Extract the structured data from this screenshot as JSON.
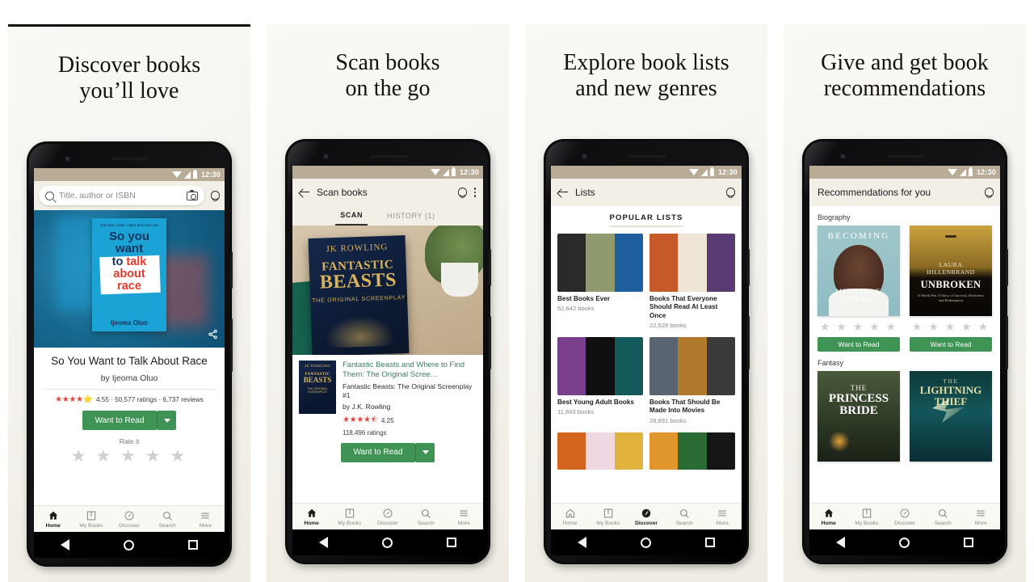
{
  "panels": [
    {
      "headline": "Discover books\nyou’ll love",
      "status": {
        "time": "12:30"
      },
      "search": {
        "placeholder": "Title, author or ISBN"
      },
      "book": {
        "cover": {
          "banner": "THE NEW YORK TIMES BESTSELLER",
          "line1": "So you",
          "line2": "want",
          "line3_dark": "to ",
          "line3_red": "talk",
          "line4_red": "about",
          "line5_red": "race",
          "author": "Ijeoma Oluo"
        },
        "title": "So You Want to Talk About Race",
        "byline": "by Ijeoma Oluo",
        "stars": "★★★★⭐",
        "rating_text": "4.55 · 50,577 ratings · 6,737 reviews",
        "cta": "Want to Read",
        "rate_it": "Rate it",
        "rate_stars": "★ ★ ★ ★ ★"
      },
      "bottom_nav_active": "Home"
    },
    {
      "headline": "Scan books\non the go",
      "status": {
        "time": "12:30"
      },
      "appbar_title": "Scan books",
      "tabs": [
        {
          "label": "SCAN",
          "active": true
        },
        {
          "label": "HISTORY (1)",
          "active": false
        }
      ],
      "result": {
        "cover_lines": {
          "a": "JK ROWLING",
          "b": "FANTASTIC",
          "c": "BEASTS",
          "d": "THE ORIGINAL SCREENPLAY"
        },
        "title": "Fantastic Beasts and Where to Find Them: The Original Scree…",
        "series": "Fantastic Beasts: The Original Screenplay #1",
        "author": "by J.K. Rowling",
        "stars": "★★★★⯪",
        "rating": "4.25",
        "ratings_count": "118,496 ratings",
        "cta": "Want to Read"
      },
      "bottom_nav_active": "Home"
    },
    {
      "headline": "Explore book lists\nand new genres",
      "status": {
        "time": "12:30"
      },
      "appbar_title": "Lists",
      "section_title": "POPULAR LISTS",
      "lists": [
        {
          "name": "Best Books Ever",
          "count": "52,642 books",
          "colors": [
            "#2a2a2a",
            "#8f9a6e",
            "#1f5f9e"
          ]
        },
        {
          "name": "Books That Everyone Should Read At Least Once",
          "count": "22,529 books",
          "colors": [
            "#c75a2a",
            "#efe6d8",
            "#5a3a72"
          ]
        },
        {
          "name": "Best Young Adult Books",
          "count": "11,843 books",
          "colors": [
            "#7a3f8c",
            "#101010",
            "#145a5a"
          ]
        },
        {
          "name": "Books That Should Be Made Into Movies",
          "count": "28,891 books",
          "colors": [
            "#5a6470",
            "#b07a2c",
            "#3a3a3a"
          ]
        }
      ],
      "partial_lists": [
        {
          "colors": [
            "#d4651f",
            "#f0d8e2",
            "#e0b23c"
          ]
        },
        {
          "colors": [
            "#e0962c",
            "#2b6b35",
            "#161616"
          ]
        }
      ],
      "bottom_nav_active": "Discover"
    },
    {
      "headline": "Give and get book\nrecommendations",
      "status": {
        "time": "12:30"
      },
      "appbar_title": "Recommendations for you",
      "sections": [
        {
          "name": "Biography",
          "books": [
            {
              "cover": "becoming",
              "title_top": "BECOMING",
              "name_lines": "MICHELLE\nOBAMA",
              "stars": "★ ★ ★ ★ ★",
              "cta": "Want to Read"
            },
            {
              "cover": "unbroken",
              "author": "LAURA\nHILLENBRAND",
              "title_top": "UNBROKEN",
              "subtitle": "A World War II Story of Survival, Resilience and Redemption",
              "stars": "★ ★ ★ ★ ★",
              "cta": "Want to Read"
            }
          ]
        },
        {
          "name": "Fantasy",
          "books": [
            {
              "cover": "princess",
              "title_top": "THE",
              "name_lines": "PRINCESS\nBRIDE"
            },
            {
              "cover": "lightning",
              "title_top": "THE",
              "l2": "LIGHTNING",
              "l3": "THIEF"
            }
          ]
        }
      ],
      "bottom_nav_active": "Home"
    }
  ],
  "bottom_nav": [
    {
      "label": "Home",
      "icon": "home-icon"
    },
    {
      "label": "My Books",
      "icon": "book-icon"
    },
    {
      "label": "Discover",
      "icon": "compass-icon"
    },
    {
      "label": "Search",
      "icon": "search-icon"
    },
    {
      "label": "More",
      "icon": "menu-icon"
    }
  ],
  "colors": {
    "green": "#3f9455",
    "star_red": "#e2453b",
    "statusbar": "#b9ac97",
    "link_green": "#3a7f5e"
  }
}
